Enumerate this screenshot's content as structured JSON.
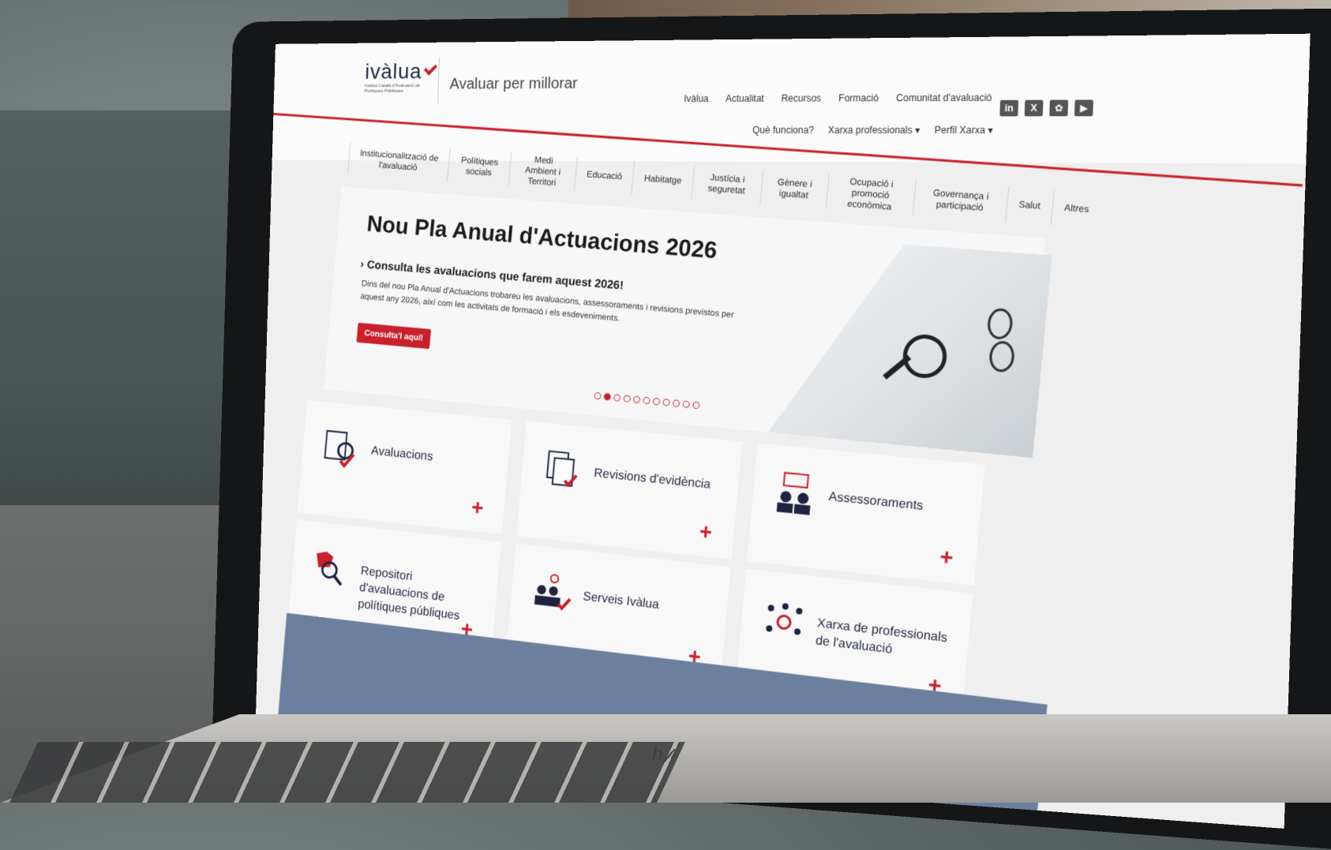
{
  "header": {
    "logo_text": "ivàlua",
    "logo_subtitle": "Institut Català d'Avaluació de Polítiques Públiques",
    "tagline": "Avaluar per millorar",
    "top_nav": [
      "Ivàlua",
      "Actualitat",
      "Recursos",
      "Formació",
      "Comunitat d'avaluació"
    ],
    "sub_nav": [
      "Què funciona?",
      "Xarxa professionals",
      "Perfil Xarxa"
    ],
    "social": [
      "in",
      "X",
      "bluesky",
      "youtube"
    ]
  },
  "categories": [
    "Institucionalització de l'avaluació",
    "Polítiques socials",
    "Medi Ambient i Territori",
    "Educació",
    "Habitatge",
    "Justícia i seguretat",
    "Gènere i igualtat",
    "Ocupació i promoció econòmica",
    "Governança i participació",
    "Salut",
    "Altres"
  ],
  "hero": {
    "title": "Nou Pla Anual d'Actuacions 2026",
    "subtitle": "Consulta les avaluacions que farem aquest 2026!",
    "text": "Dins del nou Pla Anual d'Actuacions trobareu les avaluacions, assessoraments i revisions previstos per aquest any 2026, així com les activitats de formació i els esdeveniments.",
    "button": "Consulta'l aquí!",
    "slide_count": 11,
    "active_slide": 2
  },
  "cards": [
    {
      "label": "Avaluacions",
      "icon": "document-magnifier-icon"
    },
    {
      "label": "Revisions d'evidència",
      "icon": "documents-check-icon"
    },
    {
      "label": "Assessoraments",
      "icon": "people-speech-icon"
    },
    {
      "label": "Repositori d'avaluacions de polítiques públiques",
      "icon": "map-magnifier-icon"
    },
    {
      "label": "Serveis Ivàlua",
      "icon": "team-gear-icon"
    },
    {
      "label": "Xarxa de professionals de l'avaluació",
      "icon": "network-people-icon"
    }
  ],
  "accent_color": "#c8202d",
  "brand_color": "#1e2440"
}
